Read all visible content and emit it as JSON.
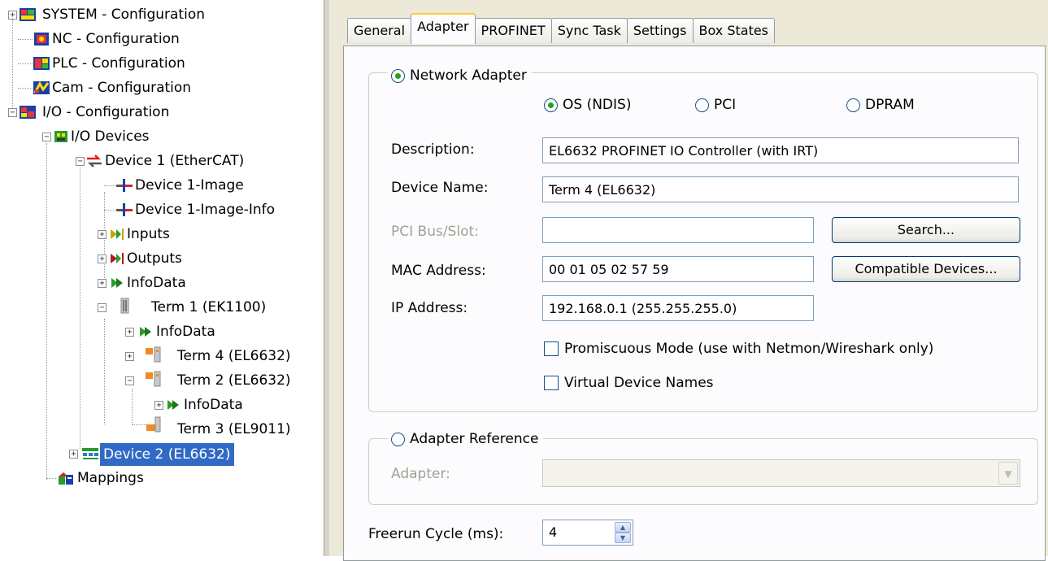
{
  "tree": {
    "system": "SYSTEM - Configuration",
    "nc": "NC - Configuration",
    "plc": "PLC - Configuration",
    "cam": "Cam - Configuration",
    "io": "I/O - Configuration",
    "io_devices": "I/O Devices",
    "device1": "Device 1 (EtherCAT)",
    "device1_image": "Device 1-Image",
    "device1_image_info": "Device 1-Image-Info",
    "inputs": "Inputs",
    "outputs": "Outputs",
    "infodata": "InfoData",
    "term1": "Term 1 (EK1100)",
    "term1_infodata": "InfoData",
    "term4": "Term 4 (EL6632)",
    "term2": "Term 2 (EL6632)",
    "term2_infodata": "InfoData",
    "term3": "Term 3 (EL9011)",
    "device2": "Device 2 (EL6632)",
    "mappings": "Mappings",
    "expand_plus": "+",
    "expand_minus": "−"
  },
  "tabs": {
    "general": "General",
    "adapter": "Adapter",
    "profinet": "PROFINET",
    "sync_task": "Sync Task",
    "settings": "Settings",
    "box_states": "Box States"
  },
  "adapter_page": {
    "network_adapter_label": "Network Adapter",
    "radio_os": "OS (NDIS)",
    "radio_pci": "PCI",
    "radio_dpram": "DPRAM",
    "description_label": "Description:",
    "description_value": "EL6632 PROFINET IO Controller (with IRT)",
    "device_name_label": "Device Name:",
    "device_name_value": "Term 4 (EL6632)",
    "pci_bus_label": "PCI Bus/Slot:",
    "pci_bus_value": "",
    "search_button": "Search...",
    "mac_label": "MAC Address:",
    "mac_value": "00 01 05 02 57 59",
    "compatible_button": "Compatible Devices...",
    "ip_label": "IP Address:",
    "ip_value": "192.168.0.1 (255.255.255.0)",
    "promiscuous_label": "Promiscuous Mode (use with Netmon/Wireshark only)",
    "virtual_names_label": "Virtual Device Names",
    "adapter_reference_label": "Adapter Reference",
    "adapter_label": "Adapter:",
    "adapter_value": "",
    "freerun_label": "Freerun Cycle (ms):",
    "freerun_value": "4"
  },
  "colors": {
    "selection": "#316ac5",
    "panel_bg": "#ece9d8",
    "tab_highlight": "#ffc83c",
    "radio_dot": "#21a121"
  }
}
